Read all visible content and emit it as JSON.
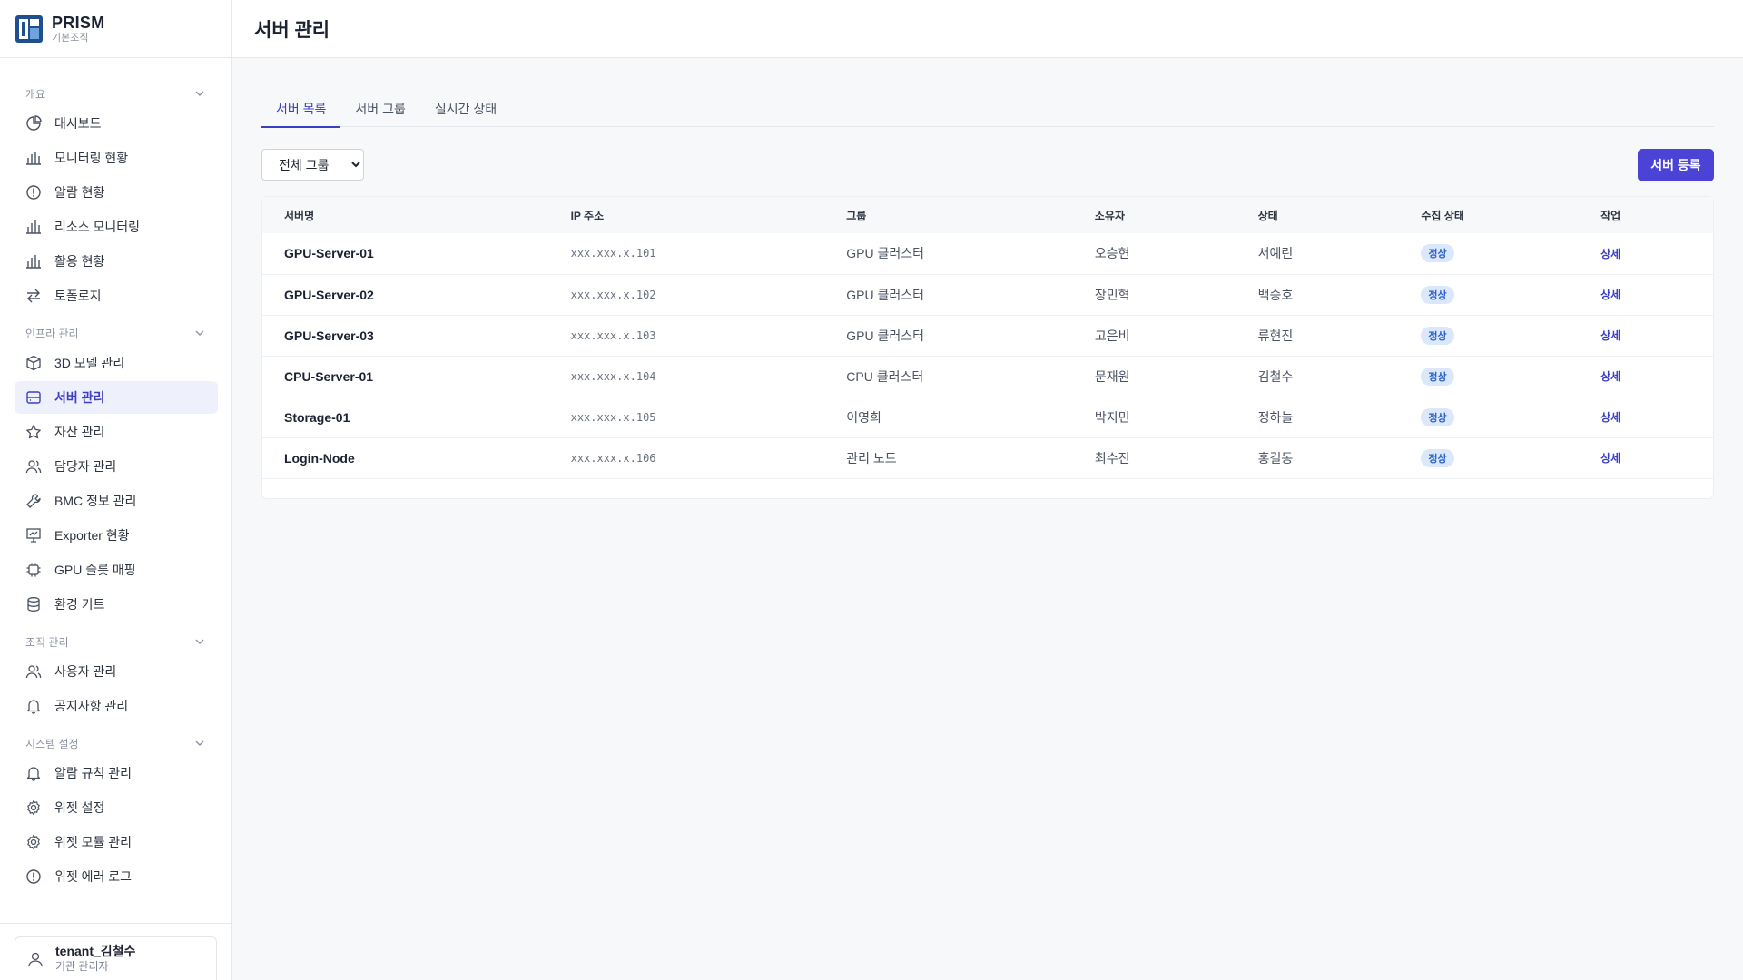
{
  "brand": {
    "name": "PRISM",
    "subtitle": "기본조직"
  },
  "header": {
    "title": "서버 관리"
  },
  "sections": [
    {
      "label": "개요",
      "items": [
        {
          "label": "대시보드",
          "icon": "pie-chart-icon"
        },
        {
          "label": "모니터링 현황",
          "icon": "bar-chart-icon"
        },
        {
          "label": "알람 현황",
          "icon": "alert-circle-icon"
        },
        {
          "label": "리소스 모니터링",
          "icon": "bar-chart-icon"
        },
        {
          "label": "활용 현황",
          "icon": "bar-chart-icon"
        },
        {
          "label": "토폴로지",
          "icon": "arrows-swap-icon"
        }
      ]
    },
    {
      "label": "인프라 관리",
      "items": [
        {
          "label": "3D 모델 관리",
          "icon": "cube-icon"
        },
        {
          "label": "서버 관리",
          "icon": "server-icon",
          "active": true
        },
        {
          "label": "자산 관리",
          "icon": "star-icon"
        },
        {
          "label": "담당자 관리",
          "icon": "users-icon"
        },
        {
          "label": "BMC 정보 관리",
          "icon": "wrench-icon"
        },
        {
          "label": "Exporter 현황",
          "icon": "presentation-icon"
        },
        {
          "label": "GPU 슬롯 매핑",
          "icon": "chip-icon"
        },
        {
          "label": "환경 키트",
          "icon": "database-icon"
        }
      ]
    },
    {
      "label": "조직 관리",
      "items": [
        {
          "label": "사용자 관리",
          "icon": "users-icon"
        },
        {
          "label": "공지사항 관리",
          "icon": "bell-icon"
        }
      ]
    },
    {
      "label": "시스템 설정",
      "items": [
        {
          "label": "알람 규칙 관리",
          "icon": "bell-icon"
        },
        {
          "label": "위젯 설정",
          "icon": "gear-icon"
        },
        {
          "label": "위젯 모듈 관리",
          "icon": "gear-icon"
        },
        {
          "label": "위젯 에러 로그",
          "icon": "alert-circle-icon"
        }
      ]
    }
  ],
  "user": {
    "name": "tenant_김철수",
    "role": "기관 관리자"
  },
  "tabs": [
    {
      "label": "서버 목록",
      "active": true
    },
    {
      "label": "서버 그룹"
    },
    {
      "label": "실시간 상태"
    }
  ],
  "filter": {
    "selected": "전체 그룹"
  },
  "actions": {
    "register_label": "서버 등록"
  },
  "table": {
    "columns": [
      "서버명",
      "IP 주소",
      "그룹",
      "소유자",
      "상태",
      "수집 상태",
      "작업"
    ],
    "column_widths": [
      316,
      304,
      274,
      180,
      180,
      198,
      148
    ],
    "rows": [
      {
        "name": "GPU-Server-01",
        "ip": "xxx.xxx.x.101",
        "group": "GPU 클러스터",
        "owner": "오승현",
        "status": "서예린",
        "collect": "정상",
        "action": "상세"
      },
      {
        "name": "GPU-Server-02",
        "ip": "xxx.xxx.x.102",
        "group": "GPU 클러스터",
        "owner": "장민혁",
        "status": "백승호",
        "collect": "정상",
        "action": "상세"
      },
      {
        "name": "GPU-Server-03",
        "ip": "xxx.xxx.x.103",
        "group": "GPU 클러스터",
        "owner": "고은비",
        "status": "류현진",
        "collect": "정상",
        "action": "상세"
      },
      {
        "name": "CPU-Server-01",
        "ip": "xxx.xxx.x.104",
        "group": "CPU 클러스터",
        "owner": "문재원",
        "status": "김철수",
        "collect": "정상",
        "action": "상세"
      },
      {
        "name": "Storage-01",
        "ip": "xxx.xxx.x.105",
        "group": "이영희",
        "owner": "박지민",
        "status": "정하늘",
        "collect": "정상",
        "action": "상세"
      },
      {
        "name": "Login-Node",
        "ip": "xxx.xxx.x.106",
        "group": "관리 노드",
        "owner": "최수진",
        "status": "홍길동",
        "collect": "정상",
        "action": "상세"
      }
    ]
  },
  "colors": {
    "accent": "#4b43d6",
    "active_nav_bg": "#eef0fb",
    "badge_bg": "#dbe8fb",
    "badge_text": "#2a62c9"
  }
}
